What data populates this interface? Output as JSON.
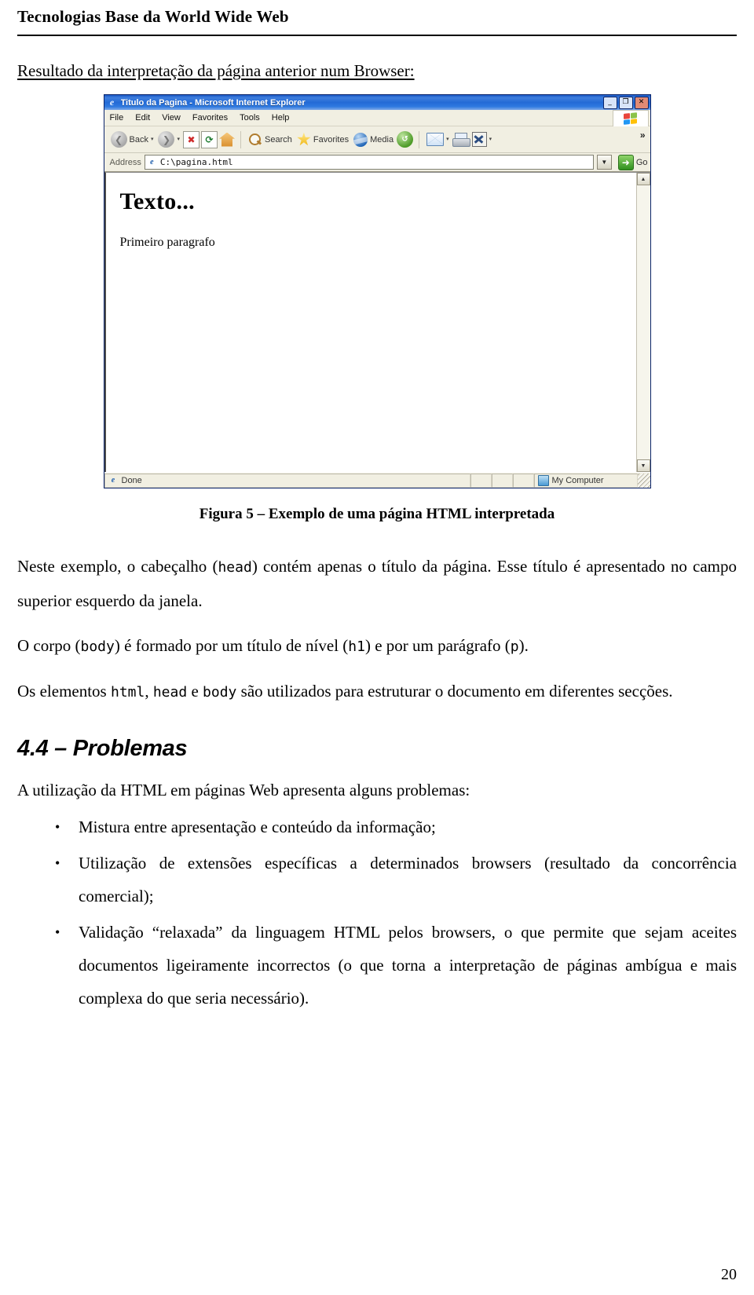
{
  "header": {
    "title": "Tecnologias Base da World Wide Web"
  },
  "lead": {
    "text": "Resultado da interpretação da página anterior num Browser:"
  },
  "browser": {
    "title": "Titulo da Pagina - Microsoft Internet Explorer",
    "title_icon": "internet-explorer-icon",
    "window_controls": {
      "minimize": "_",
      "maximize": "❐",
      "close": "✕"
    },
    "menu": [
      "File",
      "Edit",
      "View",
      "Favorites",
      "Tools",
      "Help"
    ],
    "brand_icon": "windows-flag-icon",
    "toolbar": {
      "back_label": "Back",
      "back_icon": "back-arrow-icon",
      "back_caret": "▾",
      "forward_icon": "forward-arrow-icon",
      "forward_caret": "▾",
      "stop_icon": "stop-icon",
      "stop_glyph": "✖",
      "refresh_icon": "refresh-icon",
      "refresh_glyph": "⟳",
      "home_icon": "home-icon",
      "search_icon": "search-icon",
      "search_label": "Search",
      "favorites_icon": "favorites-star-icon",
      "favorites_label": "Favorites",
      "media_icon": "media-globe-icon",
      "media_label": "Media",
      "history_icon": "history-icon",
      "mail_icon": "mail-icon",
      "mail_caret": "▾",
      "print_icon": "print-icon",
      "edit_icon": "edit-icon",
      "edit_caret": "▾",
      "overflow_glyph": "»"
    },
    "address": {
      "label": "Address",
      "icon": "page-file-icon",
      "value": "C:\\pagina.html",
      "dropdown_glyph": "▼",
      "go_label": "Go",
      "go_glyph": "➜"
    },
    "page": {
      "heading": "Texto...",
      "paragraph": "Primeiro paragrafo"
    },
    "scrollbar": {
      "up_glyph": "▲",
      "down_glyph": "▼"
    },
    "status": {
      "text": "Done",
      "status_icon": "internet-explorer-small-icon",
      "zone_label": "My Computer",
      "zone_icon": "my-computer-icon"
    }
  },
  "figure": {
    "caption": "Figura 5 – Exemplo de uma página HTML interpretada"
  },
  "prose": {
    "p1_a": "Neste exemplo, o cabeçalho (",
    "p1_code1": "head",
    "p1_b": ") contém apenas o título da página. Esse título é apresentado no campo superior esquerdo da janela.",
    "p2_a": "O corpo (",
    "p2_code1": "body",
    "p2_b": ") é formado por um título de nível (",
    "p2_code2": "h1",
    "p2_c": ") e por um parágrafo (",
    "p2_code3": "p",
    "p2_d": ").",
    "p3_a": "Os elementos ",
    "p3_code1": "html",
    "p3_b": ", ",
    "p3_code2": "head",
    "p3_c": " e ",
    "p3_code3": "body",
    "p3_d": " são utilizados para estruturar o documento em diferentes secções."
  },
  "section": {
    "heading": "4.4 – Problemas",
    "intro": "A utilização da HTML em páginas Web apresenta alguns problemas:",
    "bullet_glyph": "•",
    "items": [
      "Mistura entre apresentação e conteúdo da informação;",
      "Utilização de extensões específicas a determinados browsers (resultado da concorrência comercial);",
      "Validação “relaxada” da linguagem HTML pelos browsers, o que permite que sejam aceites documentos ligeiramente incorrectos (o que torna a interpretação de páginas ambígua e mais complexa do que seria necessário)."
    ]
  },
  "footer": {
    "page_number": "20"
  }
}
